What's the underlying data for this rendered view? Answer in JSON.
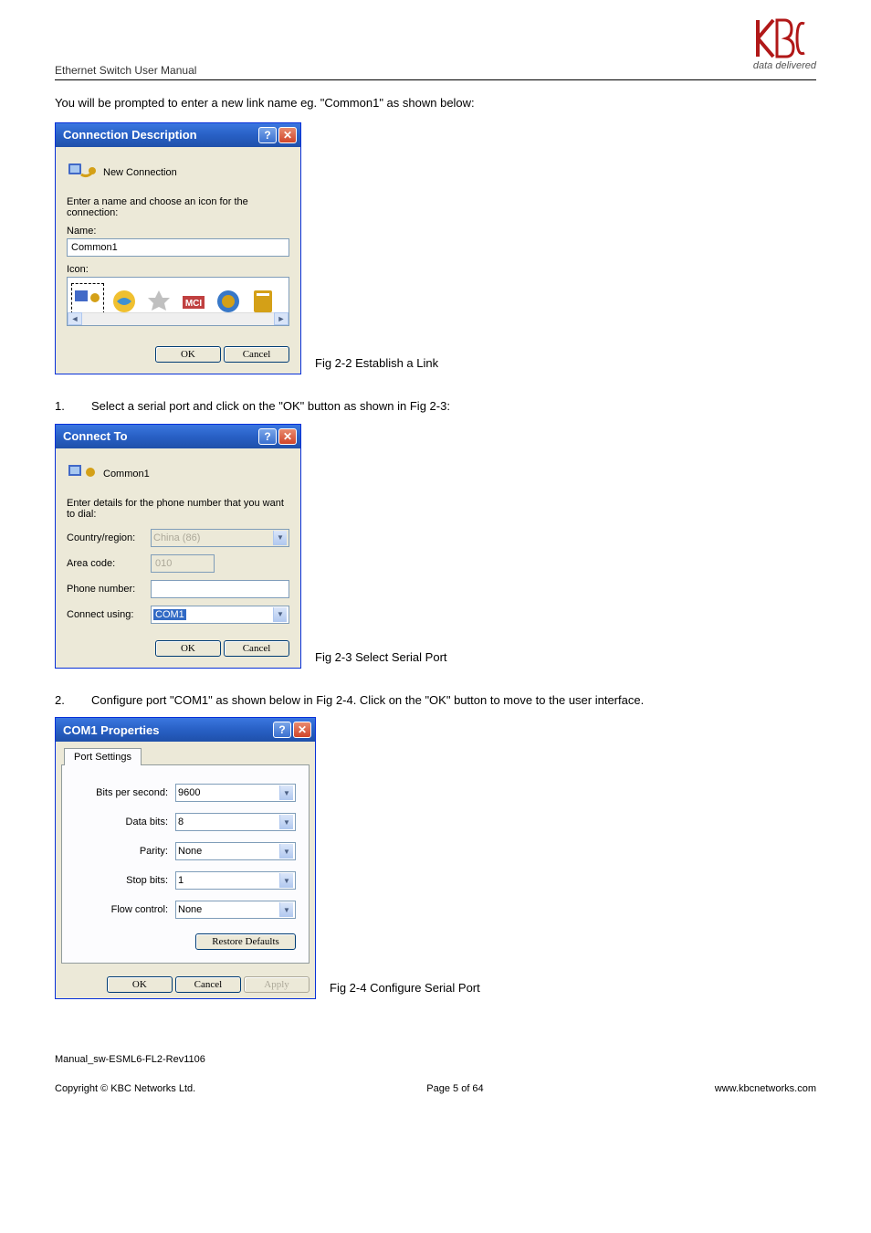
{
  "logo": {
    "tagline": "data delivered"
  },
  "header": "Ethernet Switch User Manual",
  "intro_text": "You will be prompted to enter a new link name eg. \"Common1\" as shown below:",
  "dlg1": {
    "title": "Connection Description",
    "subtitle": "New Connection",
    "prompt": "Enter a name and choose an icon for the connection:",
    "name_label": "Name:",
    "name_value": "Common1",
    "icon_label": "Icon:",
    "ok": "OK",
    "cancel": "Cancel"
  },
  "fig1_caption": "Fig 2-2 Establish a Link",
  "step1_num": "1.",
  "step1_text": "Select a serial port and click on the \"OK\" button as shown in Fig 2-3:",
  "dlg2": {
    "title": "Connect To",
    "subtitle": "Common1",
    "prompt": "Enter details for the phone number that you want to dial:",
    "country_label": "Country/region:",
    "country_value": "China (86)",
    "area_label": "Area code:",
    "area_value": "010",
    "phone_label": "Phone number:",
    "phone_value": "",
    "connect_label": "Connect using:",
    "connect_value": "COM1",
    "ok": "OK",
    "cancel": "Cancel"
  },
  "fig2_caption": "Fig 2-3 Select Serial Port",
  "step2_num": "2.",
  "step2_text": "Configure port \"COM1\" as shown below in Fig 2-4. Click on the \"OK\" button to move to the user interface.",
  "dlg3": {
    "title": "COM1 Properties",
    "tab": "Port Settings",
    "bits_label": "Bits per second:",
    "bits_value": "9600",
    "data_label": "Data bits:",
    "data_value": "8",
    "parity_label": "Parity:",
    "parity_value": "None",
    "stop_label": "Stop bits:",
    "stop_value": "1",
    "flow_label": "Flow control:",
    "flow_value": "None",
    "restore": "Restore Defaults",
    "ok": "OK",
    "cancel": "Cancel",
    "apply": "Apply"
  },
  "fig3_caption": "Fig 2-4 Configure Serial Port",
  "footer": {
    "manual_id": "Manual_sw-ESML6-FL2-Rev1106",
    "copyright": "Copyright © KBC Networks Ltd.",
    "page": "Page 5 of 64",
    "url": "www.kbcnetworks.com"
  }
}
